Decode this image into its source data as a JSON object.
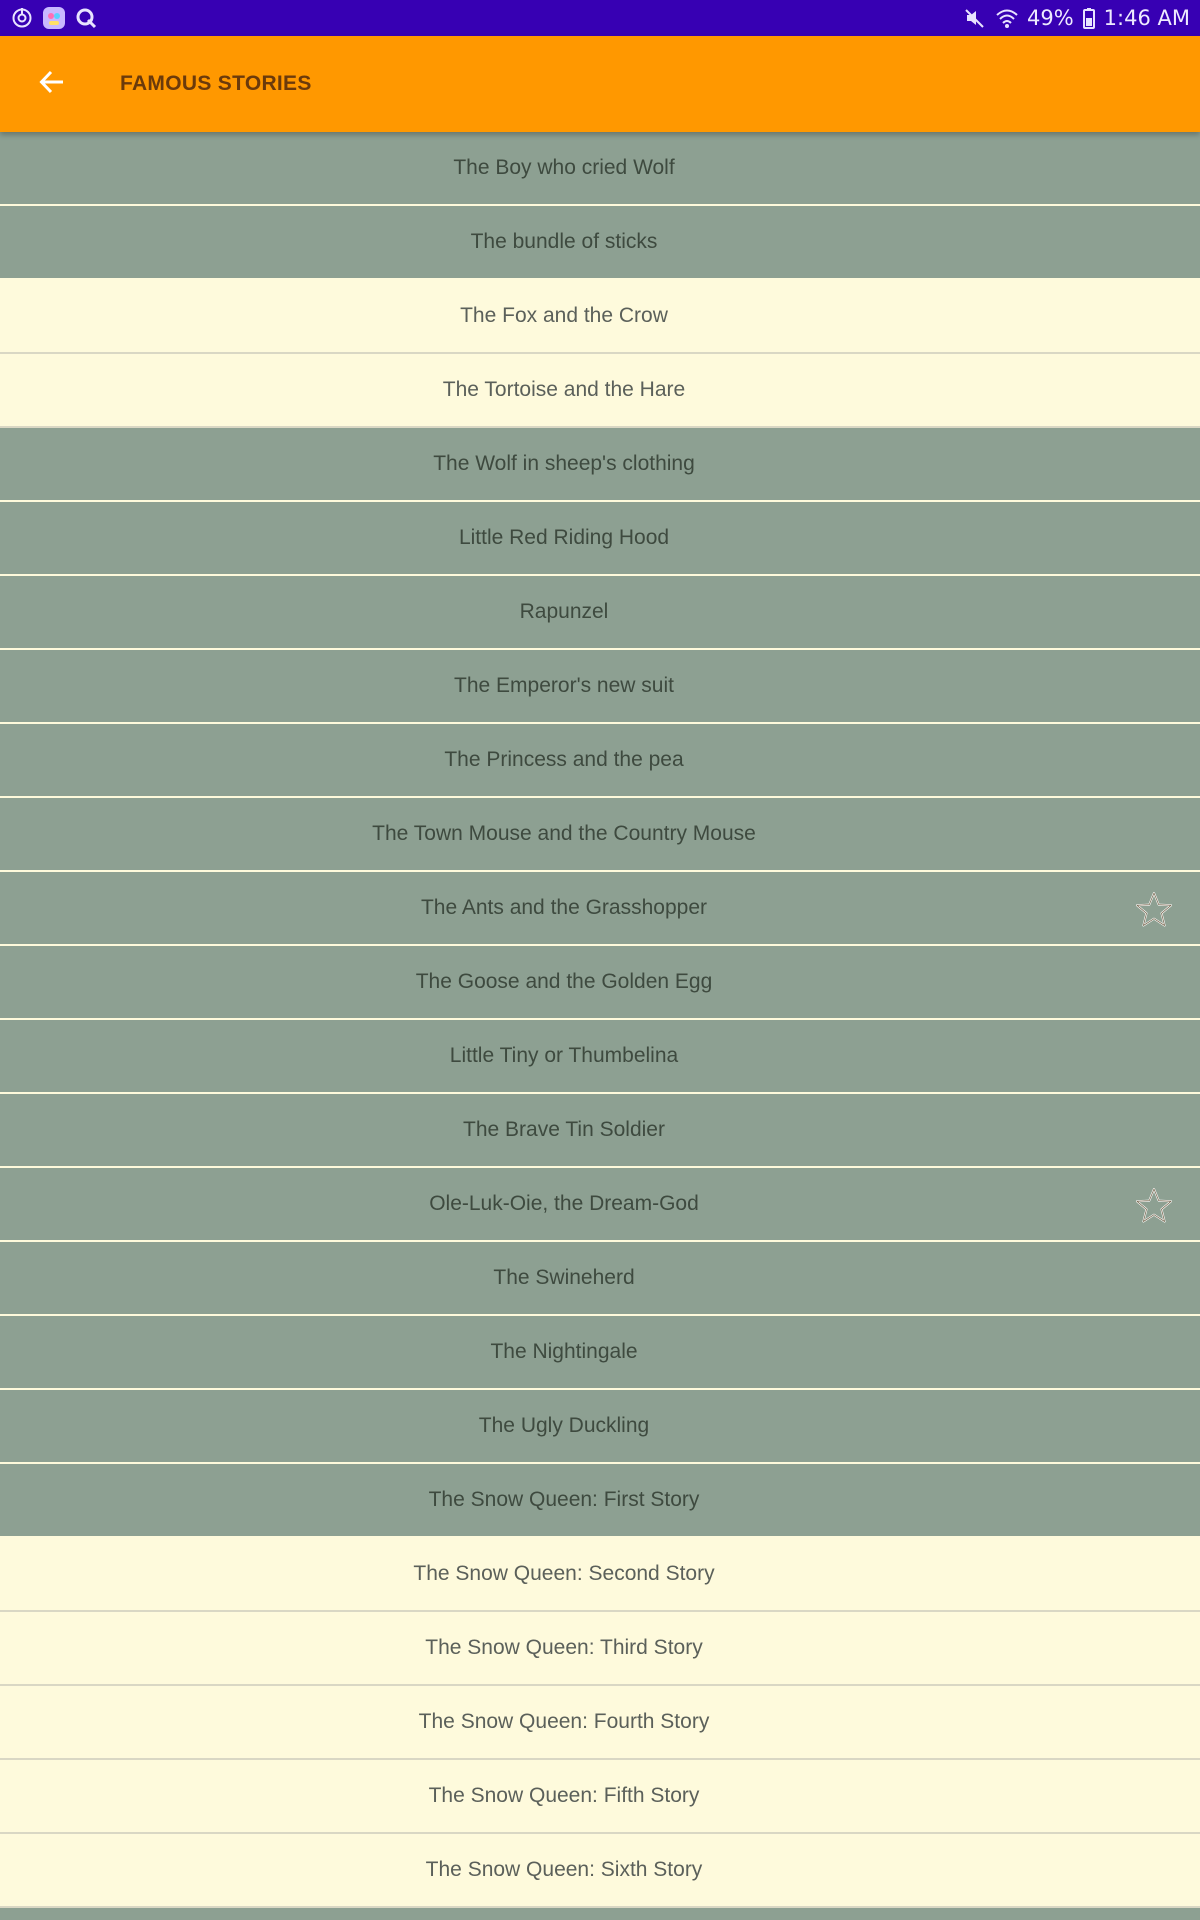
{
  "status_bar": {
    "left_icons": [
      "sync-icon",
      "app-badge-icon",
      "q-app-icon"
    ],
    "battery": "49%",
    "time": "1:46 AM",
    "right_icons": [
      "mute-icon",
      "wifi-icon",
      "battery-icon"
    ]
  },
  "app_bar": {
    "title": "FAMOUS STORIES",
    "back_icon": "arrow-back-icon"
  },
  "colors": {
    "status_bar": "#3700b3",
    "app_bar": "#ff9800",
    "row_grey": "#8da092",
    "row_cream": "#fefadc",
    "star": "#ffb300"
  },
  "stories": [
    {
      "title": "The Boy who cried Wolf",
      "style": "grey",
      "favorite": false
    },
    {
      "title": "The bundle of sticks",
      "style": "grey",
      "favorite": false
    },
    {
      "title": "The Fox and the Crow",
      "style": "cream",
      "favorite": false
    },
    {
      "title": "The Tortoise and the Hare",
      "style": "cream",
      "favorite": false
    },
    {
      "title": "The Wolf in sheep's clothing",
      "style": "grey",
      "favorite": false
    },
    {
      "title": "Little Red Riding Hood",
      "style": "grey",
      "favorite": false
    },
    {
      "title": "Rapunzel",
      "style": "grey",
      "favorite": false
    },
    {
      "title": "The Emperor's new suit",
      "style": "grey",
      "favorite": false
    },
    {
      "title": "The Princess and the pea",
      "style": "grey",
      "favorite": false
    },
    {
      "title": "The Town Mouse and the Country Mouse",
      "style": "grey",
      "favorite": false
    },
    {
      "title": "The Ants and the Grasshopper",
      "style": "grey",
      "favorite": true
    },
    {
      "title": "The Goose and the Golden Egg",
      "style": "grey",
      "favorite": false
    },
    {
      "title": "Little Tiny or Thumbelina",
      "style": "grey",
      "favorite": false
    },
    {
      "title": "The Brave Tin Soldier",
      "style": "grey",
      "favorite": false
    },
    {
      "title": "Ole-Luk-Oie, the Dream-God",
      "style": "grey",
      "favorite": true
    },
    {
      "title": "The Swineherd",
      "style": "grey",
      "favorite": false
    },
    {
      "title": "The Nightingale",
      "style": "grey",
      "favorite": false
    },
    {
      "title": "The Ugly Duckling",
      "style": "grey",
      "favorite": false
    },
    {
      "title": "The Snow Queen: First Story",
      "style": "grey",
      "favorite": false
    },
    {
      "title": "The Snow Queen: Second Story",
      "style": "cream",
      "favorite": false
    },
    {
      "title": "The Snow Queen: Third Story",
      "style": "cream",
      "favorite": false
    },
    {
      "title": "The Snow Queen: Fourth Story",
      "style": "cream",
      "favorite": false
    },
    {
      "title": "The Snow Queen: Fifth Story",
      "style": "cream",
      "favorite": false
    },
    {
      "title": "The Snow Queen: Sixth Story",
      "style": "cream",
      "favorite": false
    }
  ]
}
